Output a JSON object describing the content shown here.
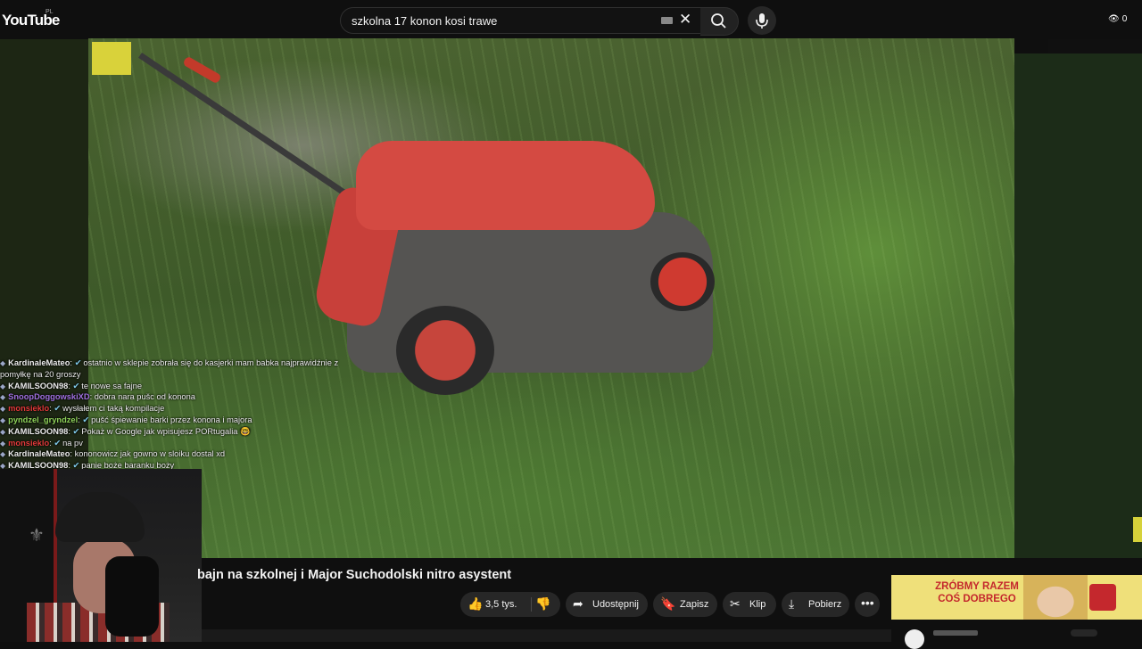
{
  "header": {
    "logo": "YouTube",
    "region": "PL",
    "search_value": "szkolna 17 konon kosi trawe",
    "viewer_count": "0",
    "icons": [
      "keyboard-icon",
      "clear-icon",
      "search-icon",
      "mic-icon",
      "eye-icon"
    ]
  },
  "video": {
    "title": "bajn na szkolnej i Major Suchodolski nitro asystent"
  },
  "actions": {
    "like_count": "3,5 tys.",
    "share": "Udostępnij",
    "save": "Zapisz",
    "clip": "Klip",
    "download": "Pobierz"
  },
  "chat": [
    {
      "user": "KardinaleMateo",
      "color": "#e8e8e8",
      "text": "ostatnio w sklepie zobrała się do kasjerki mam babka najprawidźnie z"
    },
    {
      "user": "",
      "color": "#e8e8e8",
      "text": "pomyłkę na 20 groszy"
    },
    {
      "user": "KAMILSOON98",
      "color": "#e8e8e8",
      "text": "te nowe sa fajne"
    },
    {
      "user": "SnoopDoggowskiXD",
      "color": "#a070e0",
      "text": "dobra nara pušc od konona"
    },
    {
      "user": "monsieklo",
      "color": "#e23a3a",
      "text": "wysłałem ci taką kompilacje"
    },
    {
      "user": "pyndzel_gryndzel",
      "color": "#8fd35a",
      "text": "pušć śpiewanie barki przez konona i majora"
    },
    {
      "user": "KAMILSOON98",
      "color": "#e8e8e8",
      "text": "Pokaż w Google jak wpisujesz PORtugalia 🤓"
    },
    {
      "user": "monsieklo",
      "color": "#e23a3a",
      "text": "na pv"
    },
    {
      "user": "KardinaleMateo",
      "color": "#e8e8e8",
      "text": "kononowicz jak gowno w sloiku dostal xd"
    },
    {
      "user": "KAMILSOON98",
      "color": "#e8e8e8",
      "text": "panie boże baranku boży"
    }
  ],
  "ad": {
    "line1": "ZRÓBMY RAZEM",
    "line2": "COŚ DOBREGO"
  },
  "colors": {
    "background": "#0f0f0f",
    "pill": "#272727",
    "ad_bg": "#efe07a",
    "ad_text": "#c4282d"
  }
}
